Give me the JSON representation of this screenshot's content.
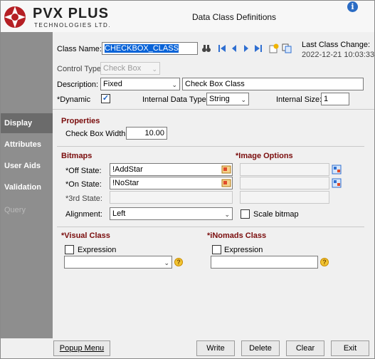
{
  "header": {
    "brand_name": "PVX PLUS",
    "brand_sub": "TECHNOLOGIES LTD.",
    "window_title": "Data Class Definitions",
    "info_glyph": "i"
  },
  "sidebar": {
    "items": [
      {
        "label": "Display"
      },
      {
        "label": "Attributes"
      },
      {
        "label": "User Aids"
      },
      {
        "label": "Validation"
      },
      {
        "label": "Query"
      }
    ]
  },
  "form": {
    "class_name_label": "Class Name:",
    "class_name_value": "CHECKBOX_CLASS",
    "last_change_label": "Last Class Change:",
    "last_change_value": "2022-12-21 10:03:33",
    "control_type_label": "Control Type:",
    "control_type_value": "Check Box",
    "description_label": "Description:",
    "description_mode": "Fixed",
    "description_value": "Check Box Class",
    "dynamic_label": "*Dynamic",
    "dynamic_checked": "✓",
    "internal_type_label": "Internal Data Type:",
    "internal_type_value": "String",
    "internal_size_label": "Internal Size:",
    "internal_size_value": "1"
  },
  "properties": {
    "heading": "Properties",
    "width_label": "Check Box Width:",
    "width_value": "10.00"
  },
  "bitmaps": {
    "heading": "Bitmaps",
    "off_label": "*Off State:",
    "off_value": "!AddStar",
    "on_label": "*On State:",
    "on_value": "!NoStar",
    "third_label": "*3rd State:",
    "third_value": "",
    "alignment_label": "Alignment:",
    "alignment_value": "Left"
  },
  "image_options": {
    "heading": "*Image Options",
    "scale_label": "Scale bitmap"
  },
  "visual_class": {
    "heading": "*Visual Class",
    "expression_label": "Expression"
  },
  "inomads_class": {
    "heading": "*iNomads Class",
    "expression_label": "Expression"
  },
  "buttons": {
    "popup": "Popup Menu",
    "write": "Write",
    "delete": "Delete",
    "clear": "Clear",
    "exit": "Exit"
  },
  "colors": {
    "section_heading": "#7a0c0c",
    "sidebar": "#8e8e8e",
    "sidebar_active": "#6b6b6b",
    "selection": "#0a64d8"
  }
}
